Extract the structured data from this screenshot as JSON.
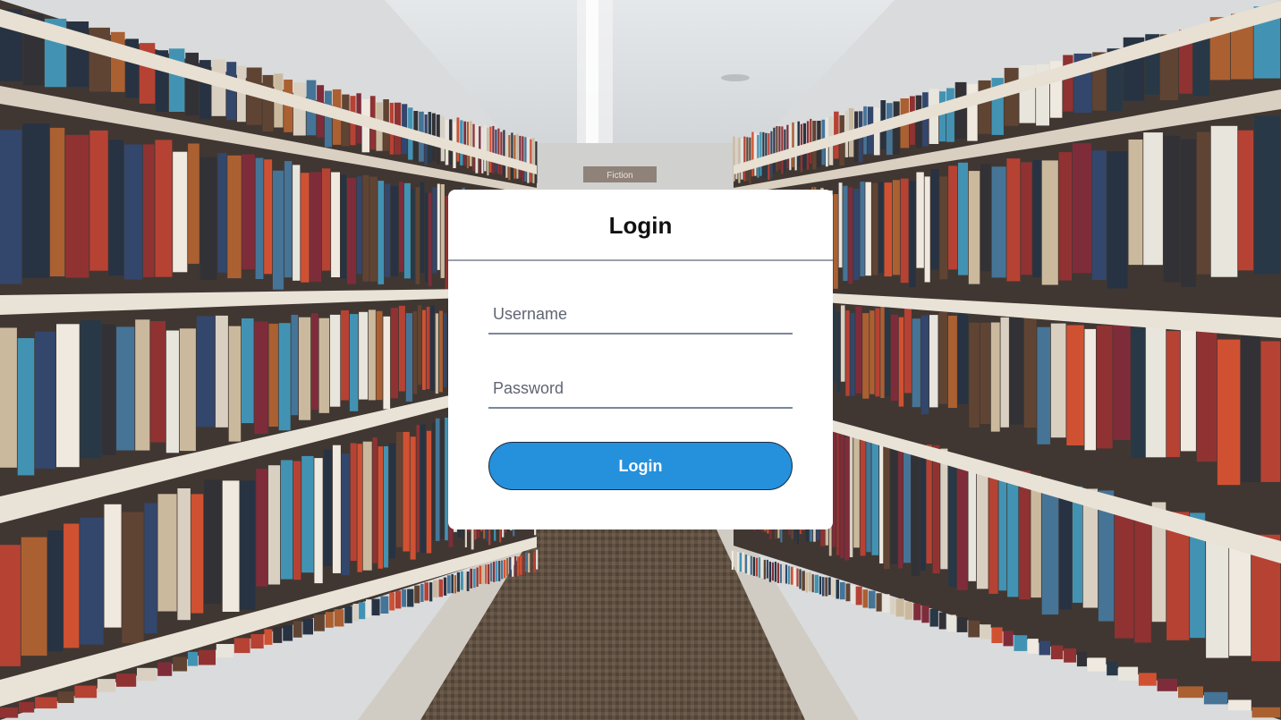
{
  "background": {
    "aisle_sign": "Fiction",
    "aisle_shelf_colors": [
      "#8c2a2a",
      "#2b3f66",
      "#c9b79b",
      "#1f2b3c",
      "#b33b2c",
      "#3e6f93",
      "#e8e4dc",
      "#5a3d2b",
      "#cf4a2a",
      "#20303f",
      "#d8cfc0",
      "#7a2432",
      "#3b8fb0",
      "#efe9df",
      "#2a2a2e",
      "#a85a2a"
    ]
  },
  "login": {
    "title": "Login",
    "username_placeholder": "Username",
    "username_value": "",
    "password_placeholder": "Password",
    "password_value": "",
    "submit_label": "Login",
    "accent_color": "#2590dc"
  }
}
